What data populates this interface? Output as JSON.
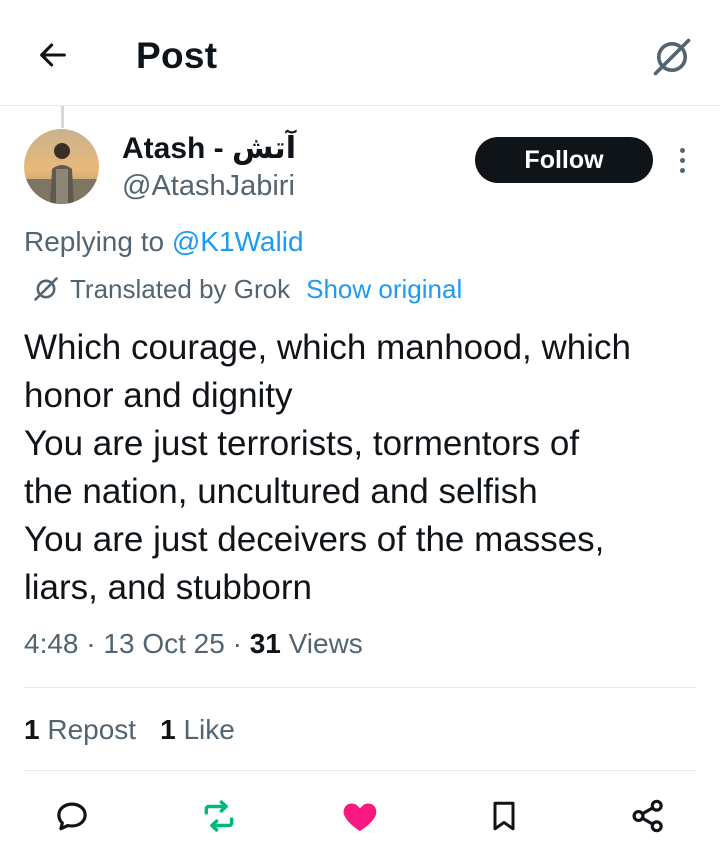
{
  "header": {
    "title": "Post",
    "back_icon": "arrow-left-icon",
    "grok_icon": "grok-icon"
  },
  "author": {
    "name": "Atash - آتش",
    "handle": "@AtashJabiri",
    "follow_label": "Follow"
  },
  "reply": {
    "prefix": "Replying to",
    "target": "@K1Walid"
  },
  "translation": {
    "label": "Translated by Grok",
    "show_original": "Show original"
  },
  "post": {
    "lines": [
      "Which courage, which manhood, which",
      "honor and dignity",
      "You are just terrorists, tormentors of",
      "the nation, uncultured and selfish",
      "You are just deceivers of the masses,",
      "liars, and stubborn"
    ]
  },
  "meta": {
    "time": "4:48",
    "date": "13 Oct 25",
    "views_count": "31",
    "views_label": "Views"
  },
  "stats": {
    "reposts_count": "1",
    "reposts_label": "Repost",
    "likes_count": "1",
    "likes_label": "Like"
  },
  "colors": {
    "accent": "#1d9bf0",
    "repost_green": "#00ba7c",
    "like_pink": "#f91880",
    "muted": "#536471",
    "text": "#0f1419"
  },
  "actions": [
    "reply-icon",
    "repost-icon",
    "like-icon",
    "bookmark-icon",
    "share-icon"
  ]
}
